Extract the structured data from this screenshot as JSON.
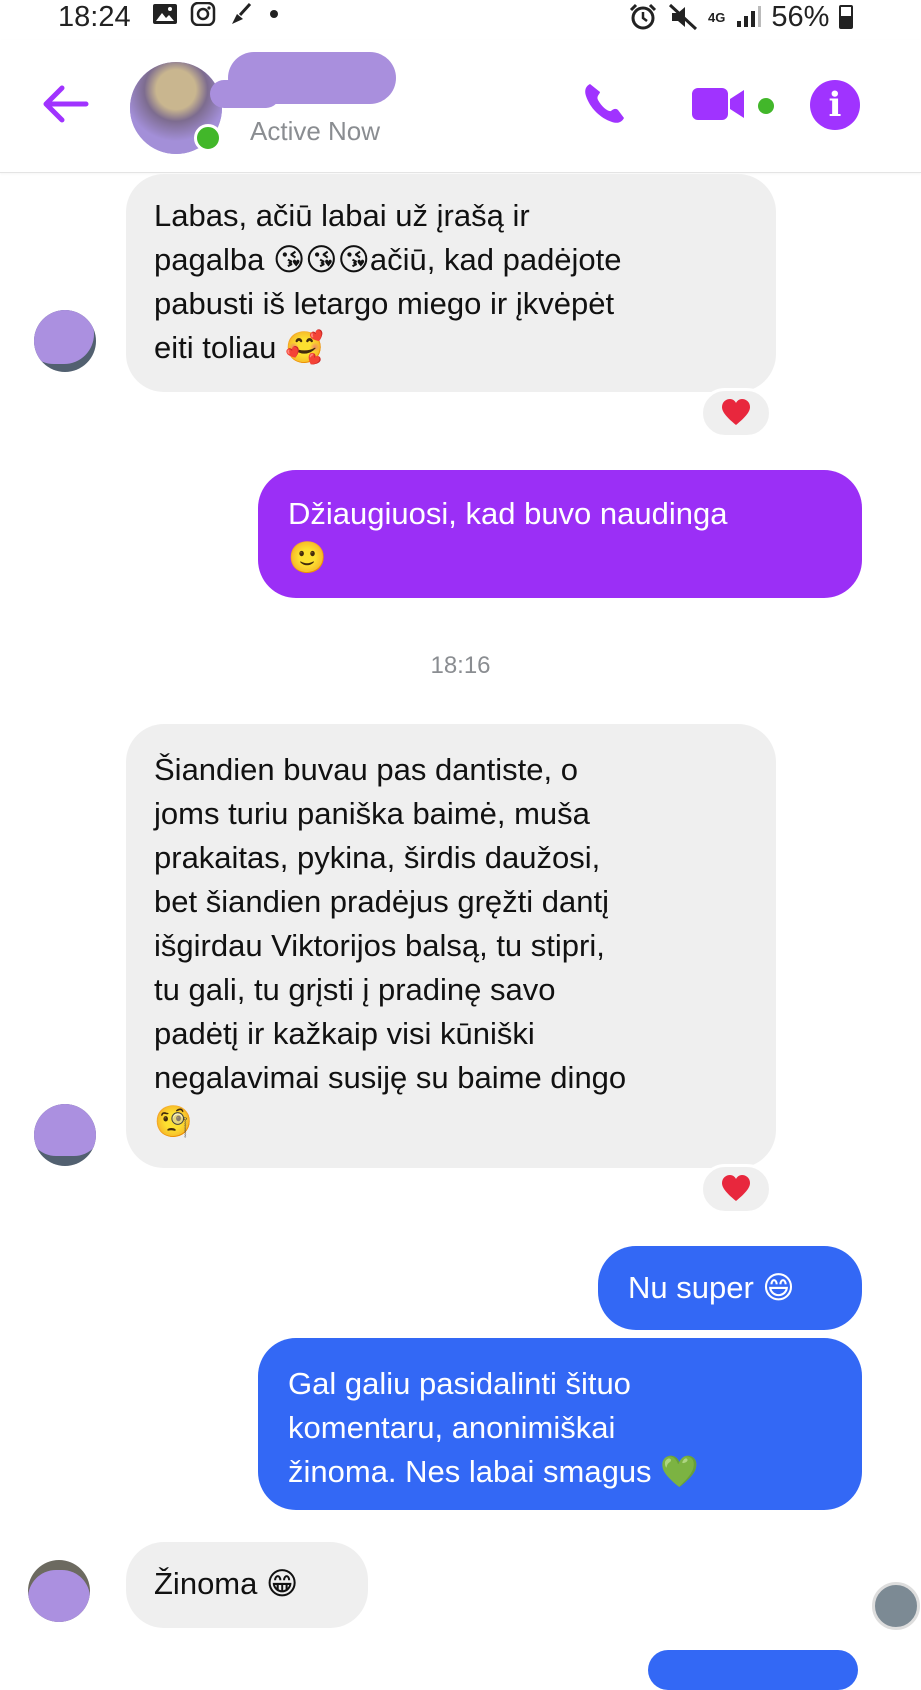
{
  "status_bar": {
    "time": "18:24",
    "network": "4G",
    "battery": "56%"
  },
  "header": {
    "status": "Active Now",
    "icons": [
      "back-arrow-icon",
      "phone-icon",
      "video-camera-icon",
      "info-icon"
    ],
    "accent_color": "#a033ff"
  },
  "messages": [
    {
      "side": "in",
      "text": "Labas, ačiū labai už įrašą ir\npagalba 😘😘😘ačiū, kad padėjote\npabusti iš letargo miego ir įkvėpėt\neiti toliau 🥰",
      "reaction": "heart"
    },
    {
      "side": "out",
      "text": "Džiaugiuosi, kad buvo naudinga\n🙂"
    },
    {
      "side": "timestamp",
      "text": "18:16"
    },
    {
      "side": "in",
      "text": "Šiandien buvau pas dantiste, o\njoms turiu paniška baimė, muša\nprakaitas, pykina, širdis daužosi,\nbet šiandien pradėjus gręžti dantį\nišgirdau Viktorijos balsą, tu stipri,\ntu gali, tu grįsti į pradinę savo\npadėtį ir kažkaip visi kūniški\nnegalavimai susiję su baime dingo\n🧐",
      "reaction": "heart"
    },
    {
      "side": "out",
      "text": "Nu super 😄"
    },
    {
      "side": "out",
      "text": "Gal galiu pasidalinti šituo\nkomentaru, anonimiškai\nžinoma. Nes labai smagus 💚"
    },
    {
      "side": "in",
      "text": "Žinoma 😁"
    }
  ],
  "colors": {
    "incoming_bubble": "#efefef",
    "outgoing_purple": "#9b2ff6",
    "outgoing_blue": "#3368f5",
    "online_dot": "#42b72a"
  }
}
